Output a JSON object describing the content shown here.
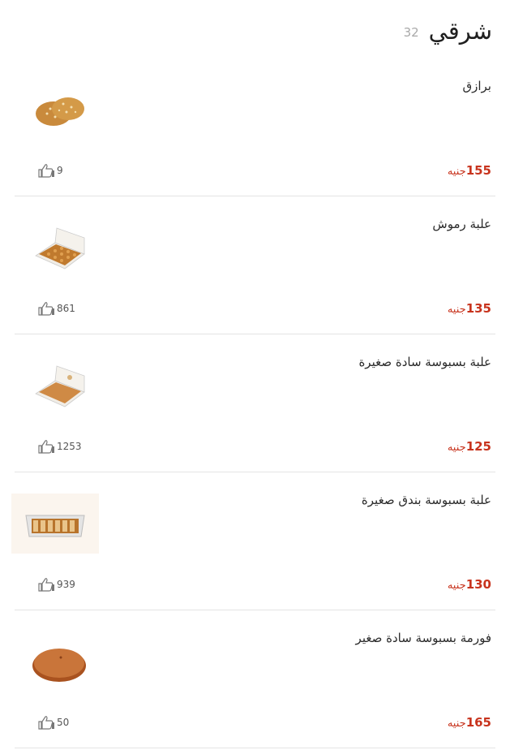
{
  "section": {
    "title": "شرقي",
    "count": "32"
  },
  "currency": "جنيه",
  "items": [
    {
      "name": "برازق",
      "price": "155",
      "likes": "9",
      "image_icon": "barazek-cookies-image"
    },
    {
      "name": "علبة رموش",
      "price": "135",
      "likes": "861",
      "image_icon": "sweets-box-image"
    },
    {
      "name": "علبة بسبوسة سادة صغيرة",
      "price": "125",
      "likes": "1253",
      "image_icon": "basbousa-box-image"
    },
    {
      "name": "علبة بسبوسة بندق صغيرة",
      "price": "130",
      "likes": "939",
      "image_icon": "hazelnut-basbousa-box-image"
    },
    {
      "name": "فورمة بسبوسة سادة صغير",
      "price": "165",
      "likes": "50",
      "image_icon": "basbousa-tray-image"
    }
  ],
  "colors": {
    "price": "#c8341e",
    "divider": "#e4e4e4",
    "count": "#a9a9a9"
  }
}
